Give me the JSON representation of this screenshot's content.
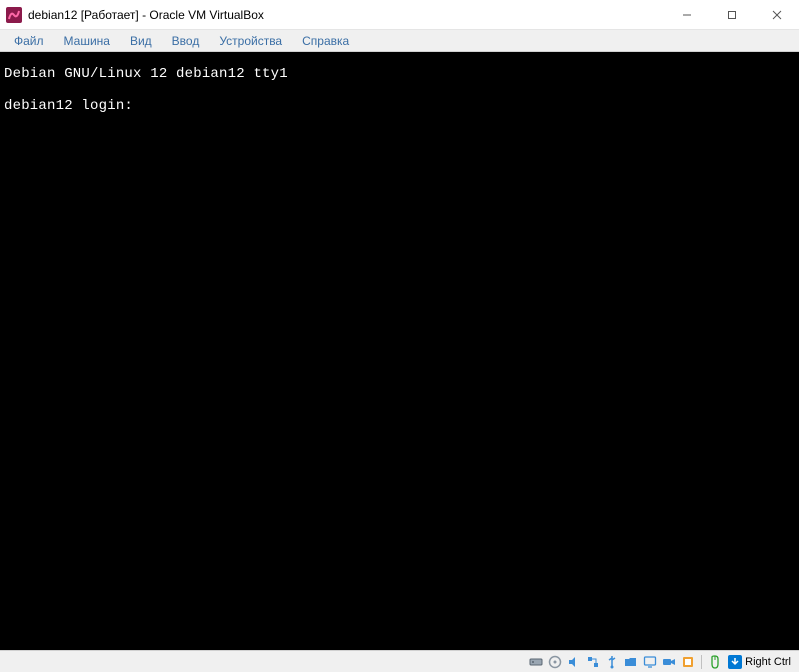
{
  "title": "debian12 [Работает] - Oracle VM VirtualBox",
  "menu": {
    "file": "Файл",
    "machine": "Машина",
    "view": "Вид",
    "input": "Ввод",
    "devices": "Устройства",
    "help": "Справка"
  },
  "terminal": {
    "line1": "Debian GNU/Linux 12 debian12 tty1",
    "blank": "",
    "prompt": "debian12 login:"
  },
  "statusbar": {
    "host_key": "Right Ctrl"
  }
}
